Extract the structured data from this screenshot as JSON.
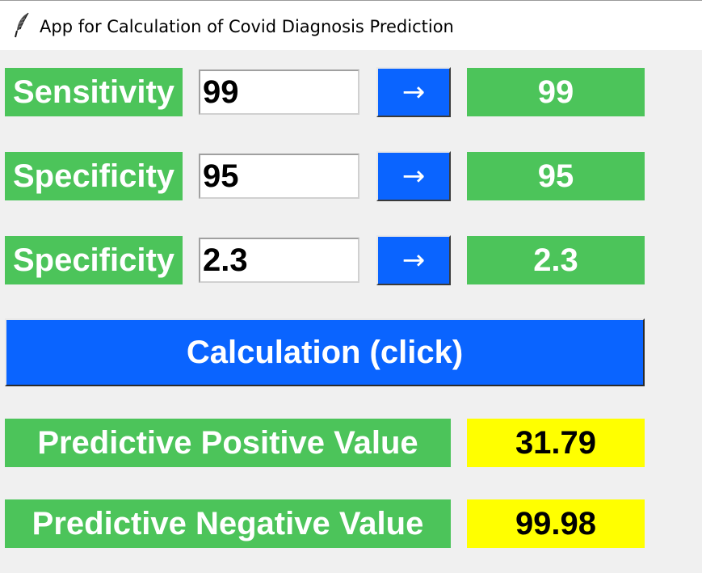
{
  "window": {
    "title": "App for Calculation of Covid Diagnosis Prediction",
    "icon": "feather-icon"
  },
  "rows": [
    {
      "label": "Sensitivity",
      "input_value": "99",
      "button_label": "→",
      "output_value": "99"
    },
    {
      "label": "Specificity",
      "input_value": "95",
      "button_label": "→",
      "output_value": "95"
    },
    {
      "label": "Specificity",
      "input_value": "2.3",
      "button_label": "→",
      "output_value": "2.3"
    }
  ],
  "calculate": {
    "label": "Calculation (click)"
  },
  "results": [
    {
      "label": "Predictive Positive Value",
      "value": "31.79"
    },
    {
      "label": "Predictive Negative Value",
      "value": "99.98"
    }
  ],
  "colors": {
    "label_bg": "#4cc45a",
    "button_bg": "#0a64ff",
    "result_bg": "#ffff00",
    "window_bg": "#f0f0f0"
  }
}
